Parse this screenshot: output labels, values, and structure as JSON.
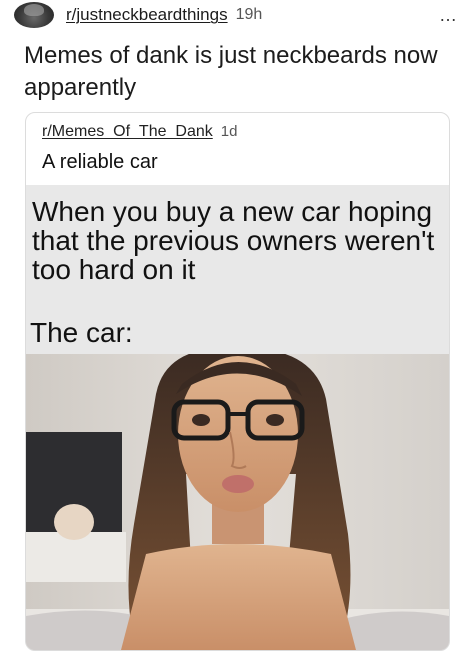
{
  "post": {
    "subreddit": "r/justneckbeardthings",
    "age": "19h",
    "more_icon": "…",
    "title": "Memes of dank is just neckbeards now apparently"
  },
  "crosspost": {
    "subreddit": "r/Memes_Of_The_Dank",
    "age": "1d",
    "title": "A reliable car"
  },
  "meme": {
    "text": "When you buy a new car hoping that the previous owners weren't too hard on it",
    "caption": "The car:"
  },
  "colors": {
    "meme_background": "#e8e8e8",
    "text": "#1c1c1c"
  }
}
